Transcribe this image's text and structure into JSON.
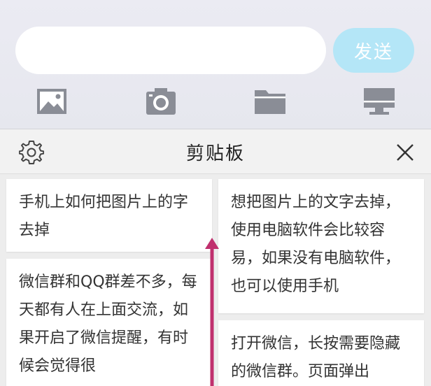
{
  "input": {
    "value": "",
    "placeholder": ""
  },
  "send_button": {
    "label": "发送"
  },
  "toolbar": {
    "icons": [
      "image-icon",
      "camera-icon",
      "folder-icon",
      "computer-icon"
    ]
  },
  "clipboard": {
    "title": "剪贴板",
    "items": [
      {
        "text": "手机上如何把图片上的字去掉"
      },
      {
        "text": "微信群和QQ群差不多，每天都有人在上面交流，如果开启了微信提醒，有时候会觉得很"
      },
      {
        "text": "想把图片上的文字去掉，使用电脑软件会比较容易，如果没有电脑软件，也可以使用手机"
      },
      {
        "text": "打开微信，长按需要隐藏的微信群。页面弹出"
      }
    ]
  },
  "colors": {
    "send_button_bg": "#b4e6f7",
    "arrow": "#c0306e",
    "icon_gray": "#8a8d96"
  }
}
